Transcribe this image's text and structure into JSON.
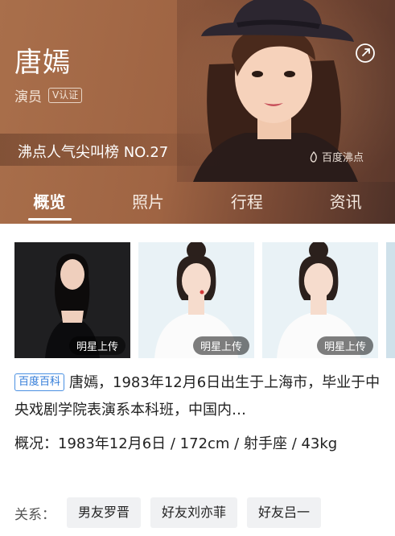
{
  "profile": {
    "name": "唐嫣",
    "role": "演员",
    "verified_badge": "V认证",
    "rank_text": "沸点人气尖叫榜 NO.27",
    "watermark": "百度沸点"
  },
  "tabs": [
    "概览",
    "照片",
    "行程",
    "资讯"
  ],
  "photos": [
    {
      "tag": "明星上传"
    },
    {
      "tag": "明星上传"
    },
    {
      "tag": "明星上传"
    }
  ],
  "intro": {
    "badge": "百度百科",
    "text": "唐嫣，1983年12月6日出生于上海市，毕业于中央戏剧学院表演系本科班，中国内…"
  },
  "detail": {
    "label": "概况：",
    "text": "1983年12月6日 / 172cm / 射手座 / 43kg"
  },
  "relations": {
    "label": "关系：",
    "items": [
      "男友罗晋",
      "好友刘亦菲",
      "好友吕一"
    ]
  },
  "icons": {
    "share": "share-icon",
    "watermark": "flame-icon"
  },
  "colors": {
    "hero": "#9f6443",
    "baike": "#2f7ad8"
  }
}
